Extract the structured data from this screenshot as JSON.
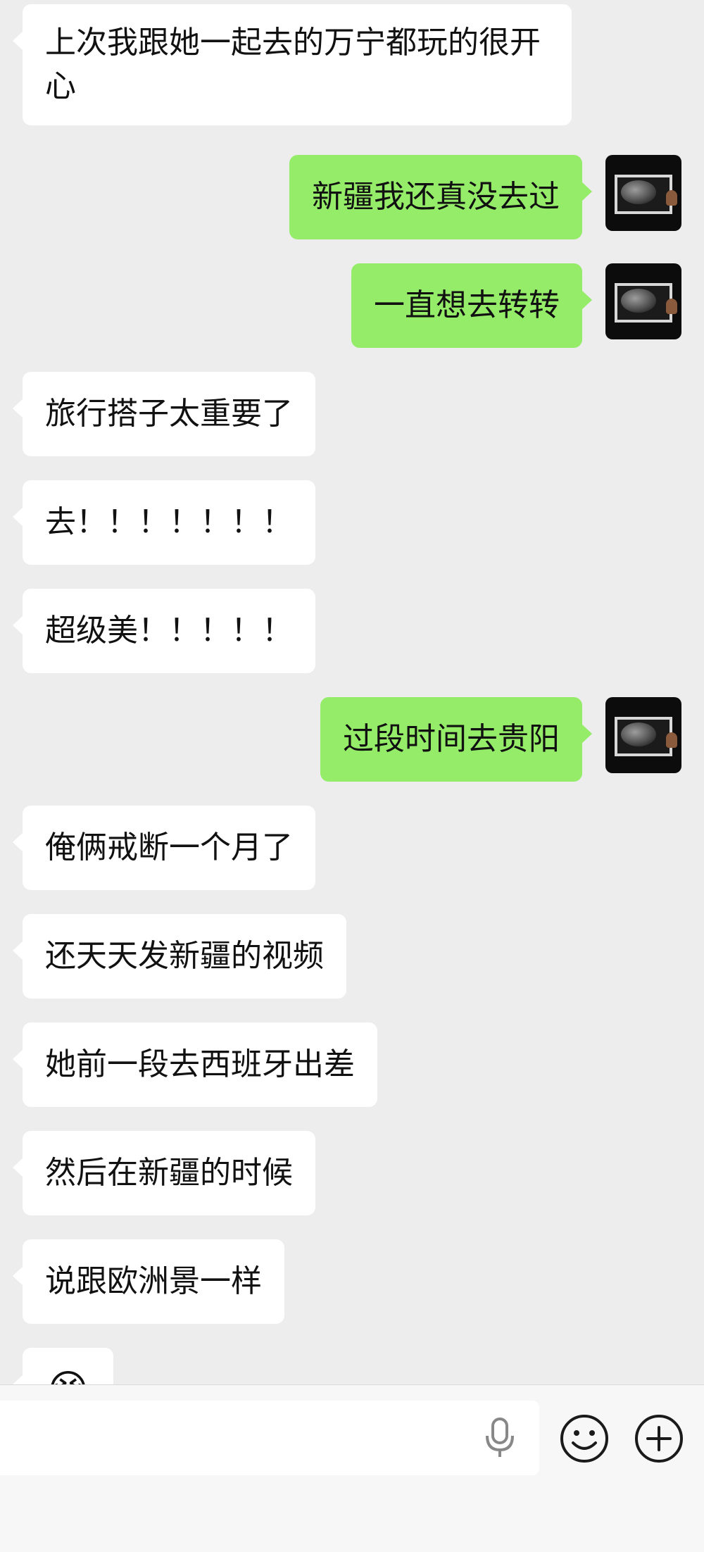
{
  "messages": [
    {
      "side": "in",
      "text": "上次我跟她一起去的万宁都玩的很开心"
    },
    {
      "side": "out",
      "text": "新疆我还真没去过"
    },
    {
      "side": "out",
      "text": "一直想去转转"
    },
    {
      "side": "in",
      "text": "旅行搭子太重要了"
    },
    {
      "side": "in",
      "text": "去！！！！！！！"
    },
    {
      "side": "in",
      "text": "超级美！！！！！"
    },
    {
      "side": "out",
      "text": "过段时间去贵阳"
    },
    {
      "side": "in",
      "text": "俺俩戒断一个月了"
    },
    {
      "side": "in",
      "text": "还天天发新疆的视频"
    },
    {
      "side": "in",
      "text": "她前一段去西班牙出差"
    },
    {
      "side": "in",
      "text": "然后在新疆的时候"
    },
    {
      "side": "in",
      "text": "说跟欧洲景一样"
    },
    {
      "side": "in",
      "emoji": "😭"
    }
  ],
  "input_bar": {
    "text_value": "",
    "icons": [
      "microphone-icon",
      "emoji-icon",
      "plus-icon"
    ]
  },
  "colors": {
    "background": "#ededed",
    "incoming_bubble": "#ffffff",
    "outgoing_bubble": "#95ec69",
    "input_bar": "#f7f7f7"
  }
}
